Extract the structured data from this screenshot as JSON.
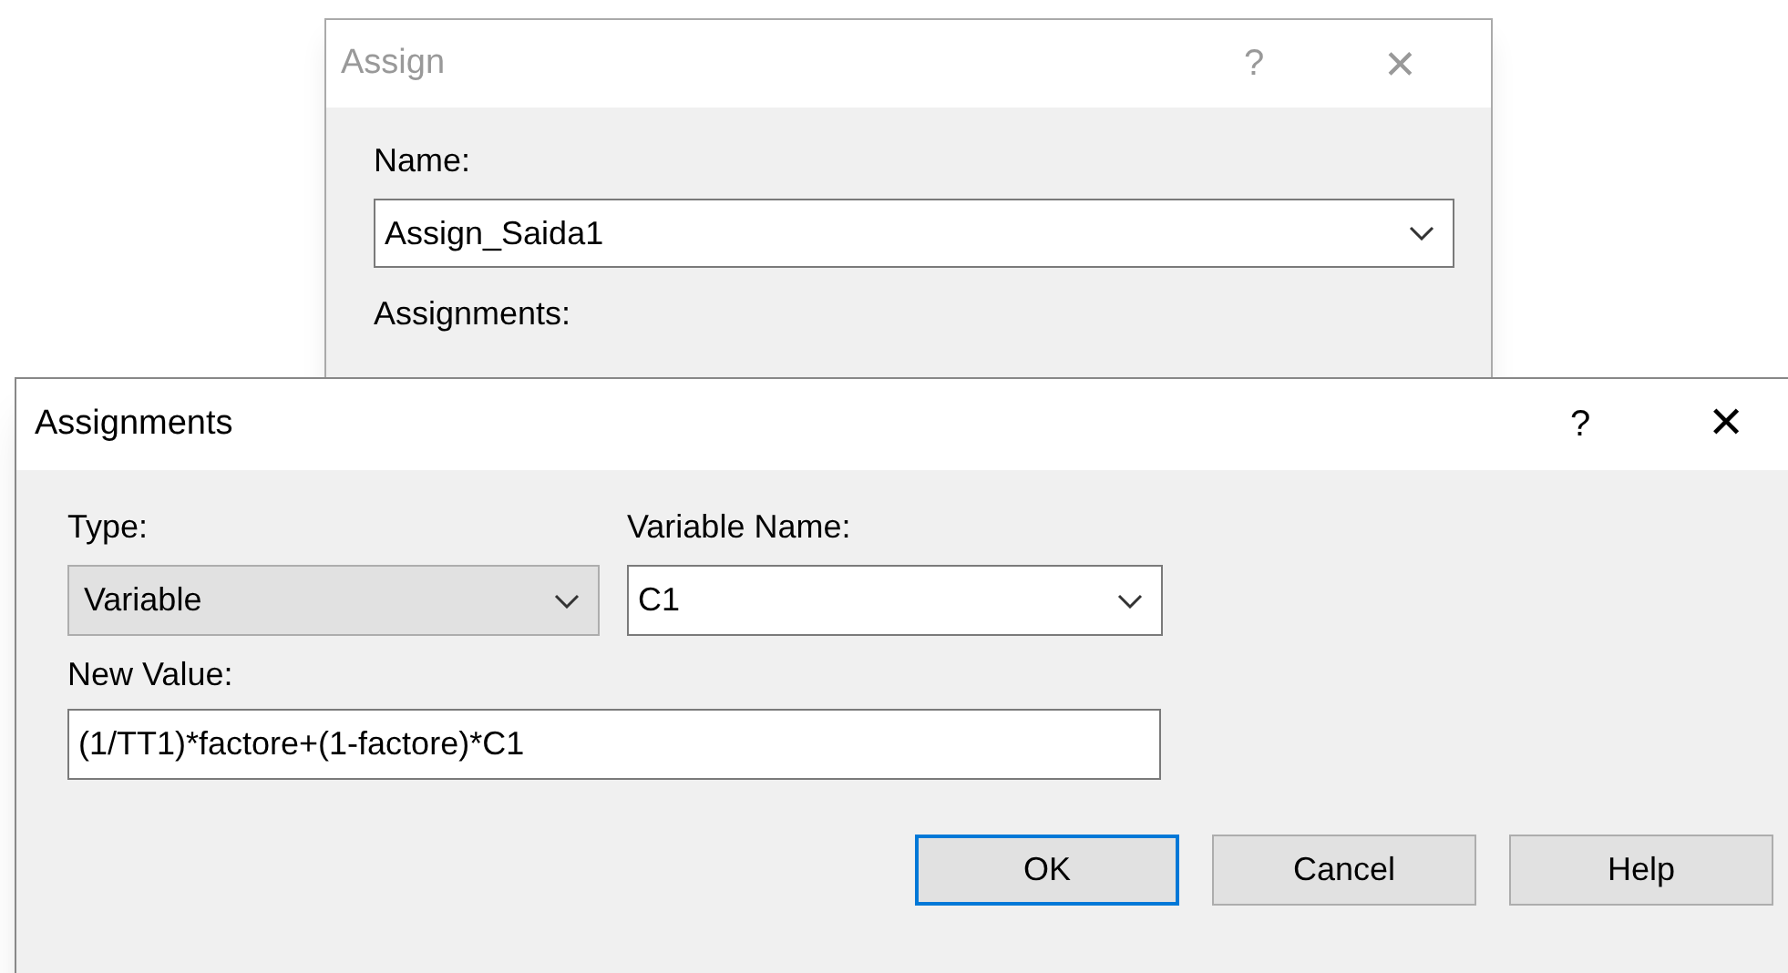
{
  "windows": [
    {
      "title": "Assign",
      "active": false,
      "help_glyph": "?",
      "close_glyph": "✕",
      "fields": [
        {
          "label": "Name:",
          "kind": "combo",
          "value": "Assign_Saida1"
        }
      ],
      "section_label": "Assignments:"
    },
    {
      "title": "Assignments",
      "active": true,
      "help_glyph": "?",
      "close_glyph": "✕",
      "type_field": {
        "label": "Type:",
        "kind": "list",
        "value": "Variable"
      },
      "variable_field": {
        "label": "Variable Name:",
        "kind": "combo",
        "value": "C1"
      },
      "value_field": {
        "label": "New Value:",
        "value": "(1/TT1)*factore+(1-factore)*C1"
      },
      "buttons": [
        {
          "label": "OK",
          "default": true
        },
        {
          "label": "Cancel",
          "default": false
        },
        {
          "label": "Help",
          "default": false
        }
      ]
    }
  ]
}
